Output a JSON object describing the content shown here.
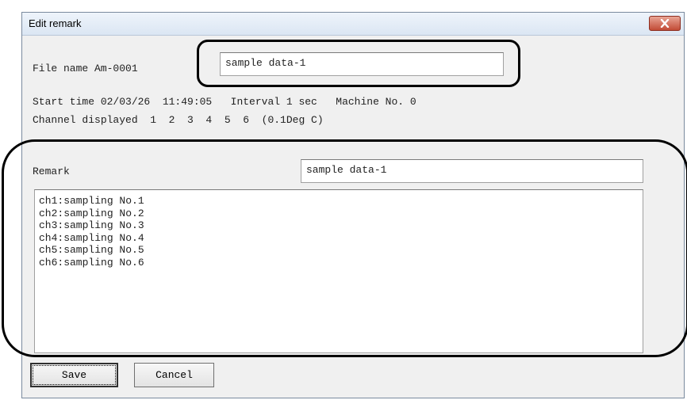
{
  "dialog": {
    "title": "Edit remark",
    "close_icon": "close-x-icon",
    "close_color": "#c24b36"
  },
  "info": {
    "file_name_label": "File name Am-0001",
    "file_name_value": "sample data-1",
    "start_time_line": "Start time 02/03/26  11:49:05   Interval 1 sec   Machine No. 0",
    "channel_line": "Channel displayed  1  2  3  4  5  6  (0.1Deg C)"
  },
  "remark": {
    "label": "Remark",
    "value": "sample data-1",
    "lines": [
      "ch1:sampling No.1",
      "ch2:sampling No.2",
      "ch3:sampling No.3",
      "ch4:sampling No.4",
      "ch5:sampling No.5",
      "ch6:sampling No.6"
    ]
  },
  "buttons": {
    "save": "Save",
    "cancel": "Cancel"
  }
}
